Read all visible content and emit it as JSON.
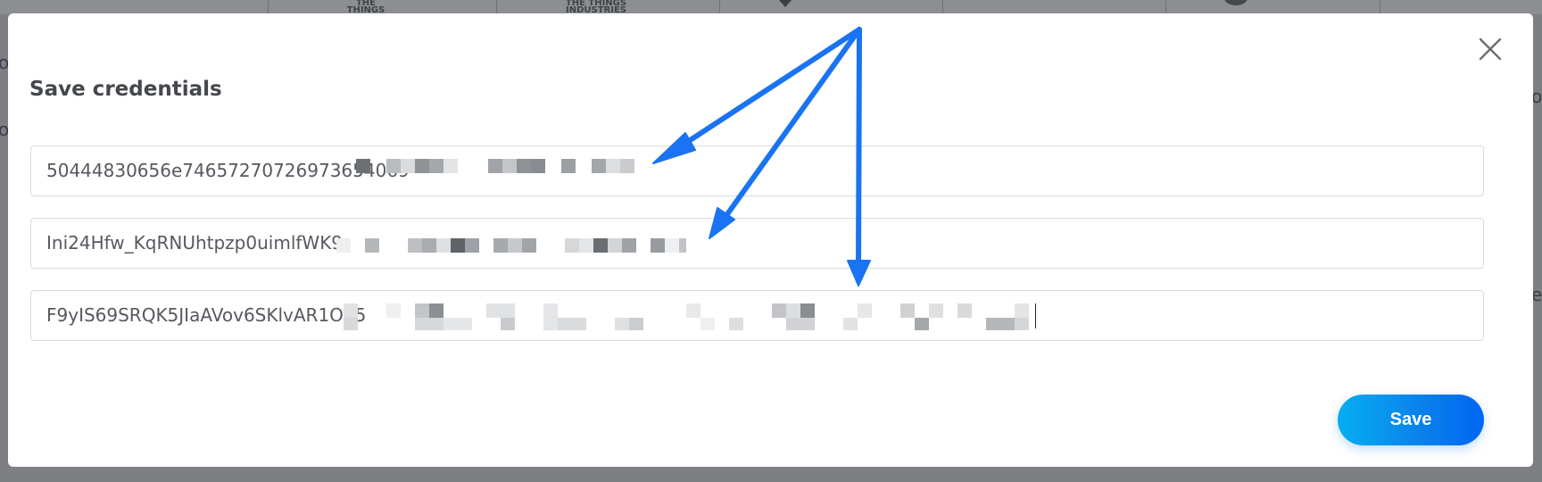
{
  "background": {
    "logo_left": "THE THINGS\nNETWORK",
    "logo_right": "THE THINGS\nINDUSTRIES",
    "edge_letters": [
      "o",
      "o",
      "o",
      "e"
    ]
  },
  "modal": {
    "title": "Save credentials",
    "fields": [
      {
        "value": "50444830656e74657270726973654069"
      },
      {
        "value": "Ini24Hfw_KqRNUhtpzp0uimlfWK9"
      },
      {
        "value": "F9yIS69SRQK5JIaAVov6SKlvAR1O75"
      }
    ],
    "save_label": "Save"
  },
  "colors": {
    "save_gradient_start": "#06aef0",
    "save_gradient_end": "#0066f2",
    "annotation_arrow": "#1a73f2"
  }
}
